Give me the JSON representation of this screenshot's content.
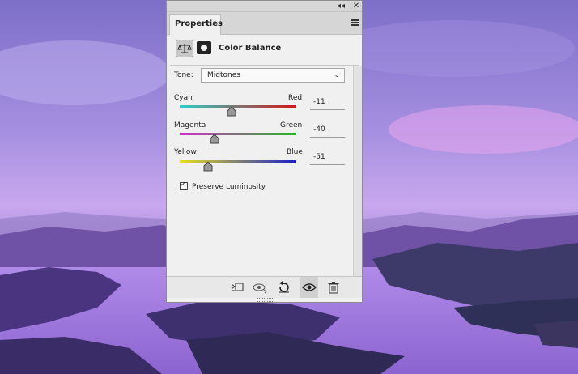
{
  "panel": {
    "tab_label": "Properties",
    "collapse_glyph": "◂◂",
    "close_glyph": "✕",
    "adjustment_title": "Color Balance",
    "tone": {
      "label": "Tone:",
      "value": "Midtones"
    },
    "sliders": [
      {
        "left": "Cyan",
        "right": "Red",
        "value": "-11",
        "level": -11,
        "range": [
          -100,
          100
        ],
        "left_color": "#2ad0c8",
        "right_color": "#d01818"
      },
      {
        "left": "Magenta",
        "right": "Green",
        "value": "-40",
        "level": -40,
        "range": [
          -100,
          100
        ],
        "left_color": "#d030c8",
        "right_color": "#28b828"
      },
      {
        "left": "Yellow",
        "right": "Blue",
        "value": "-51",
        "level": -51,
        "range": [
          -100,
          100
        ],
        "left_color": "#e8e020",
        "right_color": "#1820c8"
      }
    ],
    "preserve_luminosity": {
      "label": "Preserve Luminosity",
      "checked": true
    },
    "footer_icons": [
      "clip-to-layer-icon",
      "view-previous-state-icon",
      "reset-icon",
      "visibility-eye-icon",
      "trash-icon"
    ]
  }
}
